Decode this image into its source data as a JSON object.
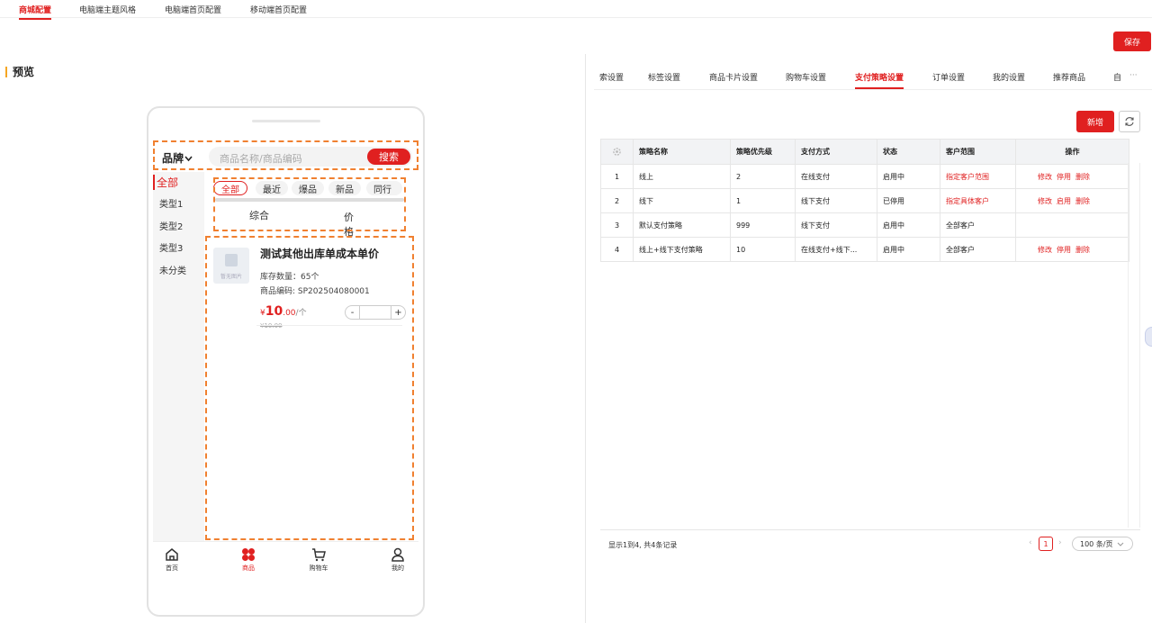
{
  "topnav": {
    "tabs": [
      "商城配置",
      "电脑端主题风格",
      "电脑端首页配置",
      "移动端首页配置"
    ],
    "active": 0
  },
  "save_label": "保存",
  "preview_title": "预览",
  "phone": {
    "brand": "品牌",
    "search_placeholder": "商品名称/商品编码",
    "search_button": "搜索",
    "categories": [
      "全部",
      "类型1",
      "类型2",
      "类型3",
      "未分类"
    ],
    "chips": [
      "全部",
      "最近",
      "爆品",
      "新品",
      "同行"
    ],
    "sort": [
      "综合",
      "价格"
    ],
    "product": {
      "no_image": "暂无图片",
      "name": "测试其他出库单成本单价",
      "stock": "库存数量：65个",
      "code": "商品编码: SP202504080001",
      "currency": "¥",
      "price_int": "10",
      "price_dec": ".00",
      "unit": "/个",
      "old_price": "¥10.00",
      "minus": "-",
      "plus": "+"
    },
    "tabbar": [
      "首页",
      "商品",
      "购物车",
      "我的"
    ]
  },
  "right": {
    "tabs": [
      "索设置",
      "标签设置",
      "商品卡片设置",
      "购物车设置",
      "支付策略设置",
      "订单设置",
      "我的设置",
      "推荐商品",
      "自",
      "···"
    ],
    "active_tab": 4,
    "add_button": "新增",
    "columns": [
      "策略名称",
      "策略优先级",
      "支付方式",
      "状态",
      "客户范围",
      "操作"
    ],
    "rows": [
      {
        "no": "1",
        "name": "线上",
        "priority": "2",
        "method": "在线支付",
        "status": "启用中",
        "scope": "指定客户范围",
        "scope_red": true,
        "ops": [
          "修改",
          "停用",
          "删除"
        ]
      },
      {
        "no": "2",
        "name": "线下",
        "priority": "1",
        "method": "线下支付",
        "status": "已停用",
        "scope": "指定具体客户",
        "scope_red": true,
        "ops": [
          "修改",
          "启用",
          "删除"
        ]
      },
      {
        "no": "3",
        "name": "默认支付策略",
        "priority": "999",
        "method": "线下支付",
        "status": "启用中",
        "scope": "全部客户",
        "scope_red": false,
        "ops": []
      },
      {
        "no": "4",
        "name": "线上+线下支付策略",
        "priority": "10",
        "method": "在线支付+线下...",
        "status": "启用中",
        "scope": "全部客户",
        "scope_red": false,
        "ops": [
          "修改",
          "停用",
          "删除"
        ]
      }
    ],
    "summary": "显示1到4, 共4条记录",
    "page": "1",
    "page_size": "100 条/页"
  },
  "colors": {
    "accent": "#e02020",
    "highlight": "#f08030"
  },
  "icons": [
    "gear-icon",
    "refresh-icon",
    "home-icon",
    "grid-icon",
    "cart-icon",
    "user-icon",
    "chevron-down-icon"
  ]
}
